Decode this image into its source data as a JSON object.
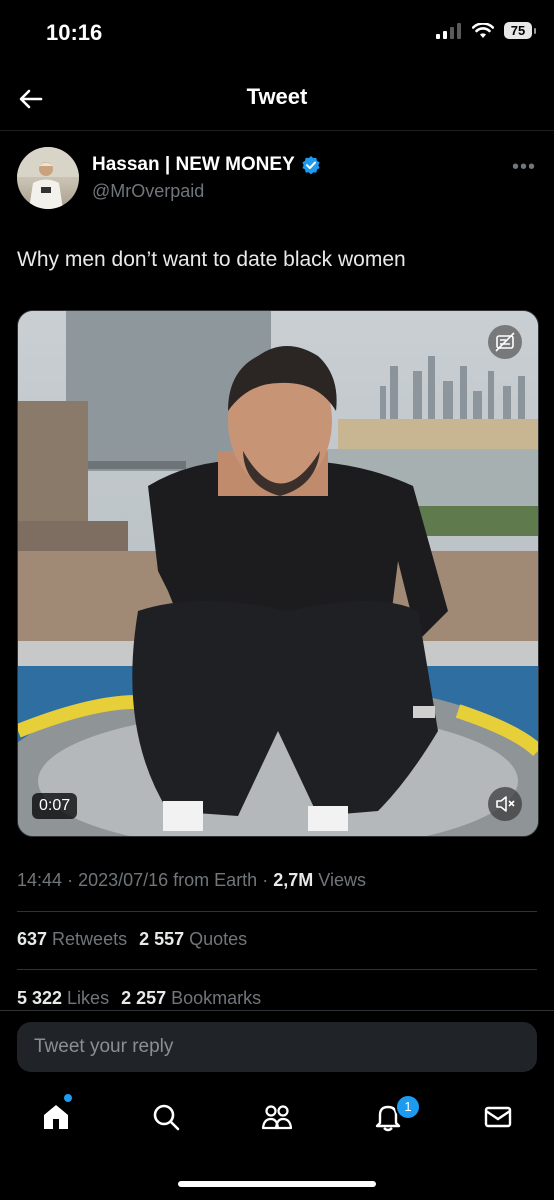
{
  "status_bar": {
    "time": "10:16",
    "battery": "75"
  },
  "header": {
    "title": "Tweet",
    "back_icon": "arrow-left-icon"
  },
  "author": {
    "name": "Hassan | NEW MONEY",
    "handle": "@MrOverpaid",
    "verified_icon": "verified-badge-icon"
  },
  "tweet": {
    "text": "Why men don’t want to date black women"
  },
  "media": {
    "duration": "0:07",
    "mute_icon": "speaker-muted-icon",
    "captions_icon": "captions-icon"
  },
  "meta": {
    "time": "14:44",
    "date": "2023/07/16",
    "source": "from Earth",
    "views_count": "2,7M",
    "views_label": "Views"
  },
  "stats": {
    "retweets_count": "637",
    "retweets_label": "Retweets",
    "quotes_count": "2 557",
    "quotes_label": "Quotes",
    "likes_count": "5 322",
    "likes_label": "Likes",
    "bookmarks_count": "2 257",
    "bookmarks_label": "Bookmarks"
  },
  "reply": {
    "placeholder": "Tweet your reply"
  },
  "tabbar": {
    "items": [
      "home-icon",
      "search-icon",
      "communities-icon",
      "notifications-icon",
      "messages-icon"
    ],
    "notification_count": "1",
    "accent": "#1d9bf0"
  }
}
